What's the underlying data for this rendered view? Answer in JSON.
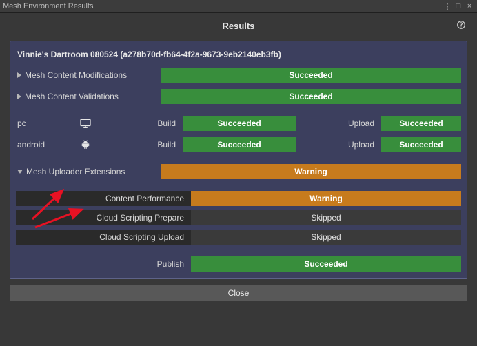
{
  "window": {
    "title": "Mesh Environment Results"
  },
  "header": {
    "title": "Results"
  },
  "panel_title": "Vinnie's Dartroom 080524 (a278b70d-fb64-4f2a-9673-9eb2140eb3fb)",
  "status_text": {
    "succeeded": "Succeeded",
    "warning": "Warning",
    "skipped": "Skipped"
  },
  "rows": {
    "mesh_content_mod": "Mesh Content Modifications",
    "mesh_content_val": "Mesh Content Validations",
    "mesh_uploader_ext": "Mesh Uploader Extensions",
    "content_perf": "Content Performance",
    "cloud_scr_prepare": "Cloud Scripting Prepare",
    "cloud_scr_upload": "Cloud Scripting Upload",
    "publish": "Publish"
  },
  "platforms": {
    "pc": "pc",
    "android": "android",
    "build_label": "Build",
    "upload_label": "Upload"
  },
  "close": "Close"
}
